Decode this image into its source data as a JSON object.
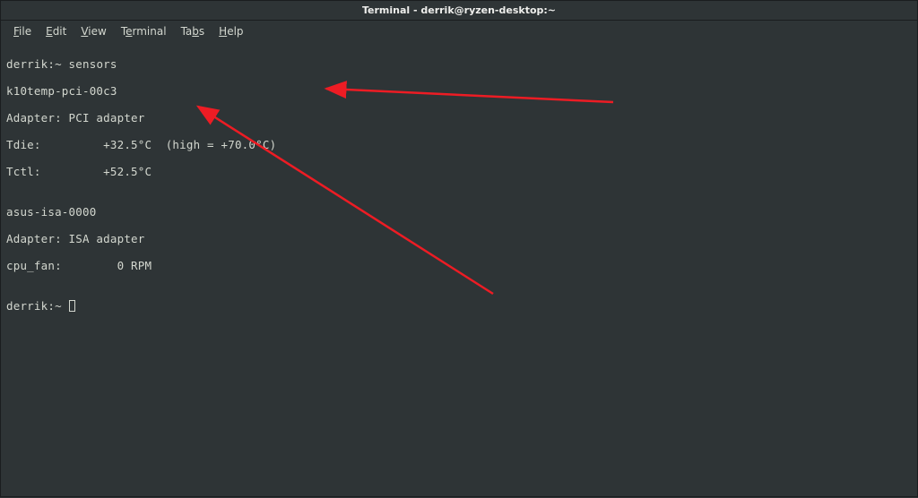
{
  "title": "Terminal - derrik@ryzen-desktop:~",
  "menu": {
    "file": "File",
    "edit": "Edit",
    "view": "View",
    "terminal": "Terminal",
    "tabs": "Tabs",
    "help": "Help"
  },
  "terminal": {
    "prompt1_host": "derrik:",
    "prompt1_tilde": "~",
    "prompt1_cmd": " sensors",
    "line_sensor1": "k10temp-pci-00c3",
    "line_adapter1": "Adapter: PCI adapter",
    "line_tdie": "Tdie:         +32.5°C  (high = +70.0°C)",
    "line_tctl": "Tctl:         +52.5°C  ",
    "line_blank1": "",
    "line_sensor2": "asus-isa-0000",
    "line_adapter2": "Adapter: ISA adapter",
    "line_cpufan": "cpu_fan:        0 RPM",
    "line_blank2": "",
    "prompt2_host": "derrik:",
    "prompt2_tilde": "~"
  },
  "annotations": {
    "arrow_color": "#ed1c24"
  }
}
